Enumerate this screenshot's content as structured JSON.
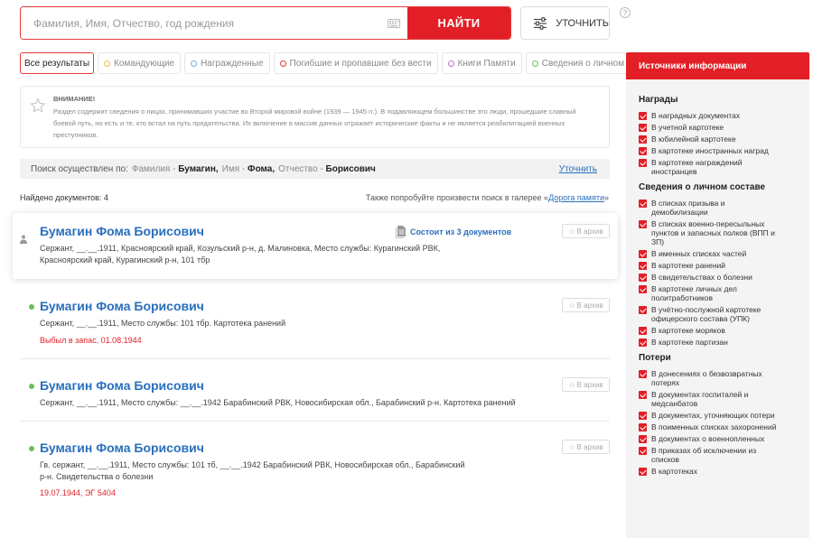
{
  "search": {
    "placeholder": "Фамилия, Имя, Отчество, год рождения",
    "find_label": "НАЙТИ",
    "refine_label": "УТОЧНИТЬ",
    "help": "?"
  },
  "tabs": [
    {
      "label": "Все результаты",
      "dot_color": ""
    },
    {
      "label": "Командующие",
      "dot_color": "#f0c040"
    },
    {
      "label": "Награжденные",
      "dot_color": "#6ab0e0"
    },
    {
      "label": "Погибшие и пропавшие без вести",
      "dot_color": "#e63b3b"
    },
    {
      "label": "Книги Памяти",
      "dot_color": "#d070c0"
    },
    {
      "label": "Сведения о личном составе",
      "dot_color": "#6dbd5b"
    }
  ],
  "warning": {
    "title": "ВНИМАНИЕ!",
    "text": "Раздел содержит сведения о лицах, принимавших участие во Второй мировой войне (1939 — 1945 гг.). В подавляющем большинстве это люди, прошедшие славный боевой путь, но есть и те, кто встал на путь предательства. Их включение в массив данных отражает исторические факты и не является реабилитацией военных преступников."
  },
  "summary": {
    "prefix": "Поиск осуществлен по:",
    "surname_label": "Фамилия -",
    "surname_value": "Бумагин,",
    "name_label": "Имя -",
    "name_value": "Фома,",
    "patronymic_label": "Отчество -",
    "patronymic_value": "Борисович",
    "refine_link": "Уточнить"
  },
  "found": "Найдено документов: 4",
  "gallery": {
    "prefix": "Также попробуйте произвести поиск в галерее «",
    "link": "Дорога памяти",
    "suffix": "»"
  },
  "results": [
    {
      "name": "Бумагин Фома Борисович",
      "details": "Сержант, __.__.1911, Красноярский край, Козульский р-н, д. Малиновка, Место службы: Курагинский РВК, Красноярский край, Курагинский р-н, 101 тбр",
      "docs": "Состоит из 3 документов",
      "archive": "В архив"
    },
    {
      "name": "Бумагин Фома Борисович",
      "details": "Сержант, __.__.1911, Место службы: 101 тбр. Картотека ранений",
      "note": "Выбыл в запас, 01.08.1944",
      "archive": "В архив"
    },
    {
      "name": "Бумагин Фома Борисович",
      "details": "Сержант, __.__.1911, Место службы: __.__.1942 Барабинский РВК, Новосибирская обл., Барабинский р-н. Картотека ранений",
      "archive": "В архив"
    },
    {
      "name": "Бумагин Фома Борисович",
      "details": "Гв. сержант, __.__.1911, Место службы: 101 тб, __.__.1942 Барабинский РВК, Новосибирская обл., Барабинский р-н. Свидетельства о болезни",
      "note": "19.07.1944, ЭГ 5404",
      "archive": "В архив"
    }
  ],
  "sidebar": {
    "title": "Источники информации",
    "sections": [
      {
        "title": "Награды",
        "items": [
          "В наградных документах",
          "В учетной картотеке",
          "В юбилейной картотеке",
          "В картотеке иностранных наград",
          "В картотеке награждений иностранцев"
        ]
      },
      {
        "title": "Сведения о личном составе",
        "items": [
          "В списках призыва и демобилизации",
          "В списках военно-пересыльных пунктов и запасных полков (ВПП и ЗП)",
          "В именных списках частей",
          "В картотеке ранений",
          "В свидетельствах о болезни",
          "В картотеке личных дел политработников",
          "В учётно-послужной картотеке офицерского состава (УПК)",
          "В картотеке моряков",
          "В картотеке партизан"
        ]
      },
      {
        "title": "Потери",
        "items": [
          "В донесениях о безвозвратных потерях",
          "В документах госпиталей и медсанбатов",
          "В документах, уточняющих потери",
          "В поименных списках захоронений",
          "В документах о военнопленных",
          "В приказах об исключении из списков",
          "В картотеках"
        ]
      }
    ]
  }
}
